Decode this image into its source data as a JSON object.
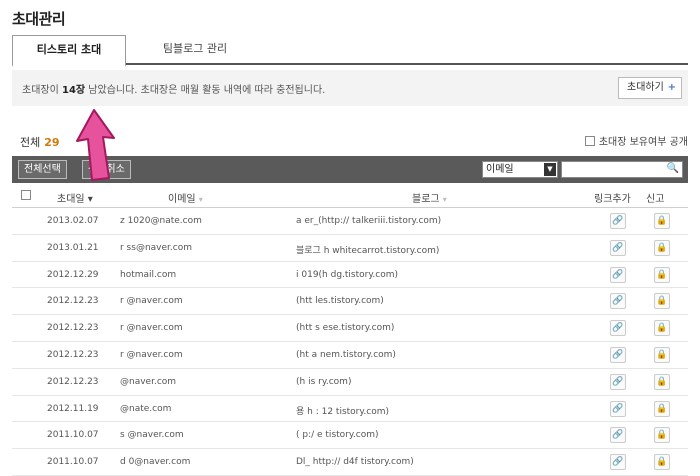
{
  "page": {
    "title": "초대관리"
  },
  "tabs": [
    {
      "label": "티스토리 초대"
    },
    {
      "label": "팀블로그 관리"
    }
  ],
  "notice": {
    "prefix": "초대장이 ",
    "count": "14장",
    "suffix": " 남았습니다. 초대장은 매월 활동 내역에 따라 충전됩니다.",
    "invite_button": "초대하기",
    "invite_plus": "+"
  },
  "summary": {
    "total_label": "전체",
    "total_count": "29",
    "public_label": "초대장 보유여부 공개"
  },
  "toolbar": {
    "select_all": "전체선택",
    "deselect": "선택취소",
    "search_type": "이메일",
    "search_value": ""
  },
  "table": {
    "headers": {
      "date": "초대일 ▾",
      "email": "이메일",
      "email_sort": "▾",
      "blog": "블로그",
      "blog_sort": "▾",
      "link": "링크추가",
      "report": "신고"
    },
    "rows": [
      {
        "date": "2013.02.07",
        "email": "z     1020@nate.com",
        "blog": "a     er_(http://    talkeriii.tistory.com)"
      },
      {
        "date": "2013.01.21",
        "email": "r       ss@naver.com",
        "blog": "     블로그 h       whitecarrot.tistory.com)"
      },
      {
        "date": "2012.12.29",
        "email": "     hotmail.com",
        "blog": "i    019(h        dg.tistory.com)"
      },
      {
        "date": "2012.12.23",
        "email": "r         @naver.com",
        "blog": "    (htt       les.tistory.com)"
      },
      {
        "date": "2012.12.23",
        "email": "r         @naver.com",
        "blog": "    (htt       s      ese.tistory.com)"
      },
      {
        "date": "2012.12.23",
        "email": "r         @naver.com",
        "blog": "    (ht          a      nem.tistory.com)"
      },
      {
        "date": "2012.12.23",
        "email": "          @naver.com",
        "blog": "    (h          is    ry.com)"
      },
      {
        "date": "2012.11.19",
        "email": "          @nate.com",
        "blog": "    용 h     :    12  tistory.com)"
      },
      {
        "date": "2011.10.07",
        "email": "s        @naver.com",
        "blog": "    (     p:/    e    tistory.com)"
      },
      {
        "date": "2011.10.07",
        "email": "d       0@naver.com",
        "blog": "Dl_  http://    d4f   tistory.com)"
      }
    ]
  },
  "icons": {
    "link": "🔗",
    "report": "🔒",
    "search": "🔍"
  }
}
